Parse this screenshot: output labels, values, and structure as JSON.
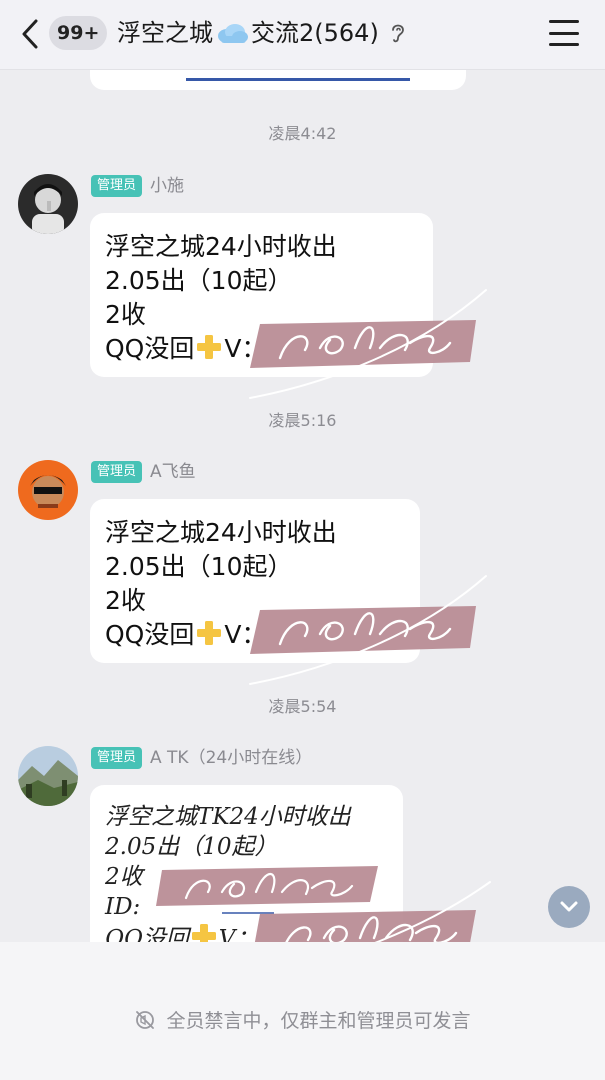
{
  "header": {
    "unread_count": "99+",
    "title_prefix": "浮空之城",
    "title_suffix": "交流2(564)",
    "icons": [
      "back-chevron-icon",
      "cloud-emoji-icon",
      "ear-icon",
      "menu-icon"
    ]
  },
  "timestamps": [
    "凌晨4:42",
    "凌晨5:16",
    "凌晨5:54"
  ],
  "messages": [
    {
      "role": "管理员",
      "sender": "小施",
      "lines": [
        "浮空之城24小时收出",
        "2.05出（10起）",
        "2收",
        "QQ没回",
        "V："
      ]
    },
    {
      "role": "管理员",
      "sender": "A飞鱼",
      "lines": [
        "浮空之城24小时收出",
        "2.05出（10起）",
        "2收",
        "QQ没回",
        "V："
      ]
    },
    {
      "role": "管理员",
      "sender": "A TK（24小时在线）",
      "lines": [
        "浮空之城TK24小时收出",
        "2.05出（10起）",
        "2收",
        "ID:",
        "QQ没回",
        "V："
      ]
    }
  ],
  "footer": {
    "muted_notice": "全员禁言中，仅群主和管理员可发言",
    "icons": [
      "mute-icon"
    ]
  },
  "colors": {
    "badge": "#47c2b6",
    "redaction": "#b78a92",
    "background": "#ededf0",
    "scroll_button": "#9aaabf"
  }
}
